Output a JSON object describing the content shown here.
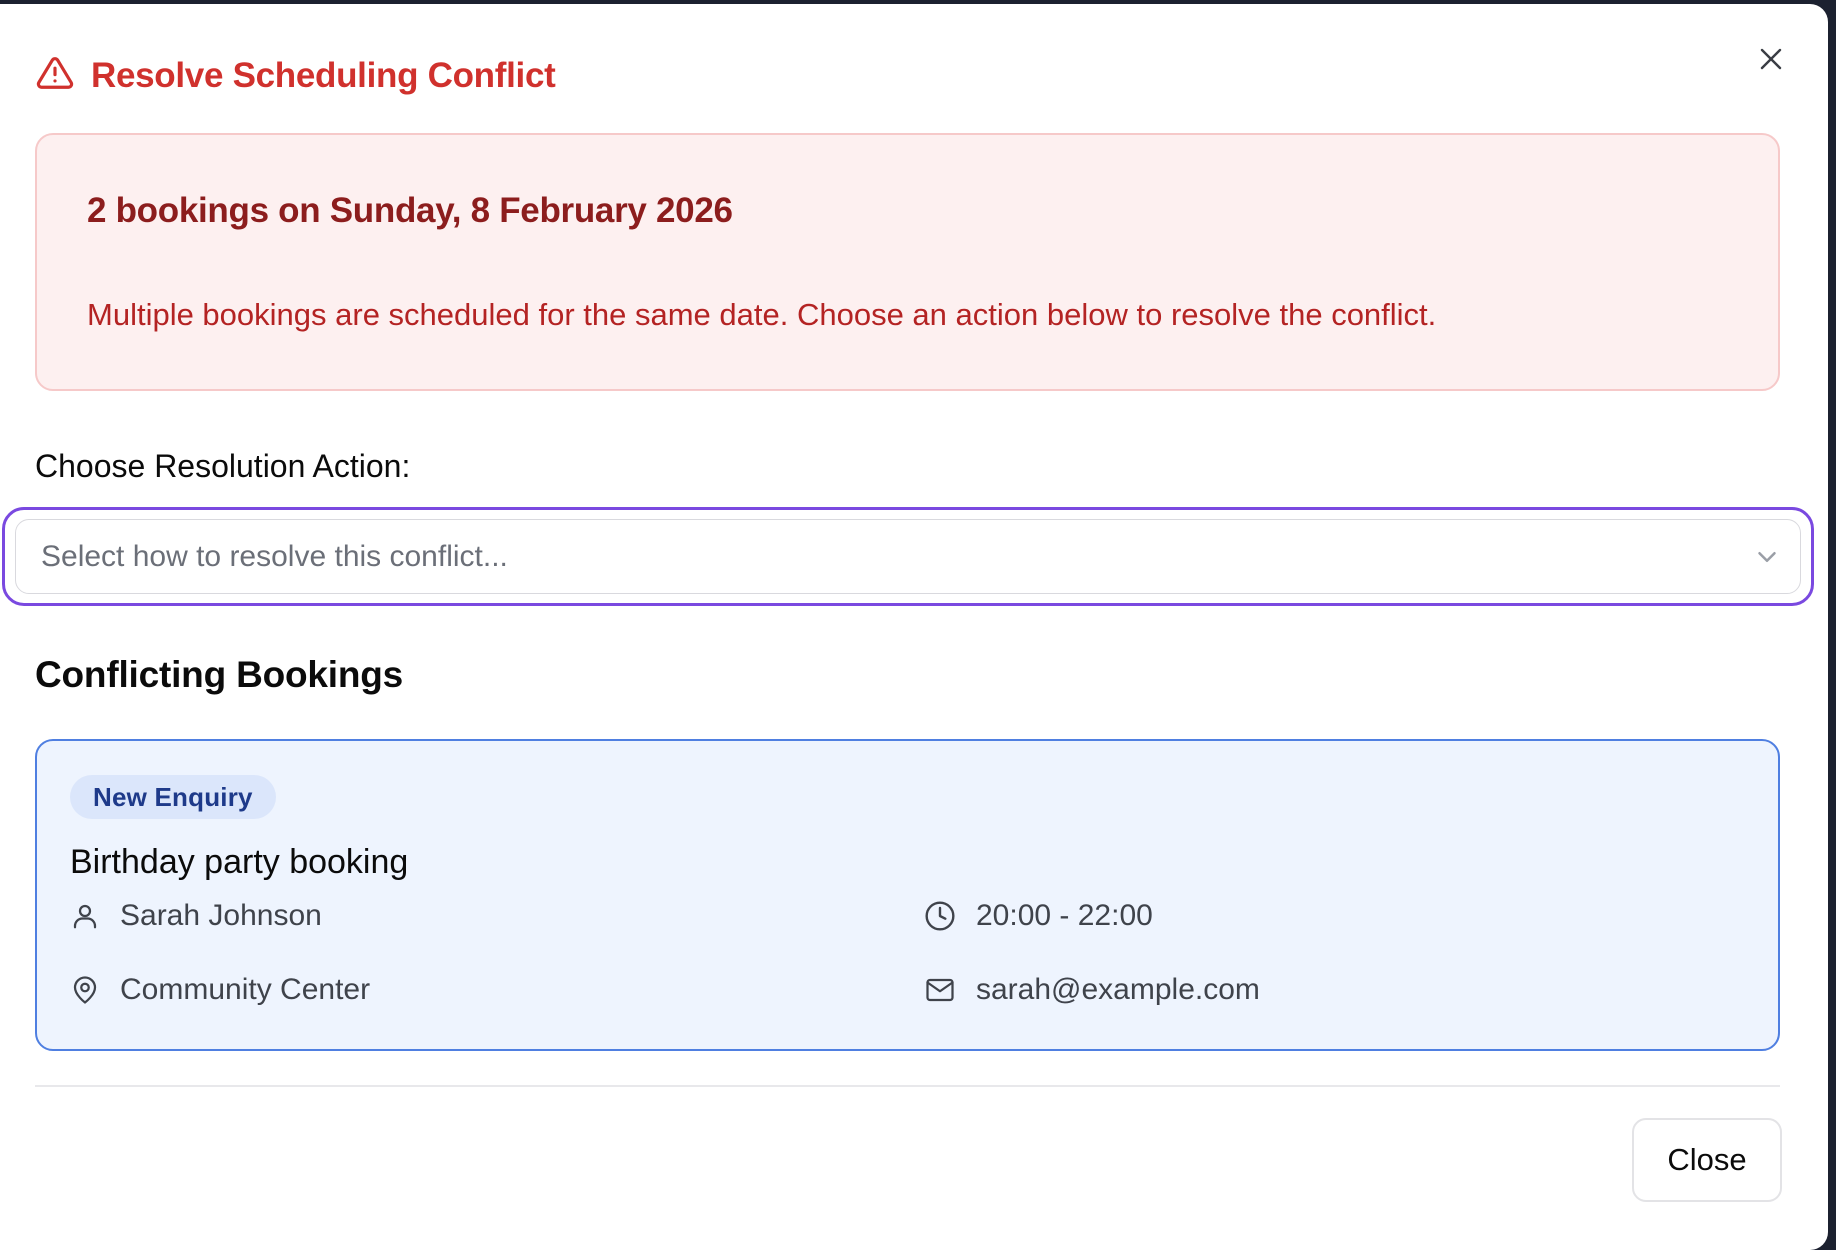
{
  "dialog": {
    "title": "Resolve Scheduling Conflict",
    "close_label": "Close"
  },
  "alert": {
    "heading": "2 bookings on Sunday, 8 February 2026",
    "message": "Multiple bookings are scheduled for the same date. Choose an action below to resolve the conflict."
  },
  "resolution": {
    "label": "Choose Resolution Action:",
    "placeholder": "Select how to resolve this conflict..."
  },
  "conflicts": {
    "heading": "Conflicting Bookings",
    "bookings": [
      {
        "status": "New Enquiry",
        "title": "Birthday party booking",
        "customer": "Sarah Johnson",
        "time": "20:00 - 22:00",
        "location": "Community Center",
        "email": "sarah@example.com"
      }
    ]
  },
  "colors": {
    "danger": "#d0312d",
    "focus_ring": "#7a49e0",
    "card_border": "#4f7fe1",
    "card_bg": "#eef4fe"
  },
  "icons": {
    "title": "alert-triangle-icon",
    "close": "close-icon",
    "select": "chevron-down-icon",
    "customer": "user-icon",
    "time": "clock-icon",
    "location": "map-pin-icon",
    "email": "mail-icon"
  }
}
